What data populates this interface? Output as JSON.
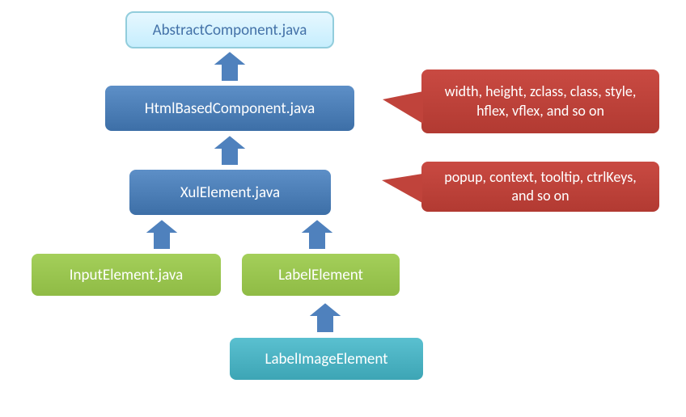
{
  "diagram": {
    "nodes": {
      "abstract_component": "AbstractComponent.java",
      "html_based_component": "HtmlBasedComponent.java",
      "xul_element": "XulElement.java",
      "input_element": "InputElement.java",
      "label_element": "LabelElement",
      "label_image_element": "LabelImageElement"
    },
    "callouts": {
      "html_based_attrs": "width, height, zclass, class, style, hflex, vflex, and so on",
      "xul_element_attrs": "popup, context, tooltip, ctrlKeys, and so on"
    }
  }
}
